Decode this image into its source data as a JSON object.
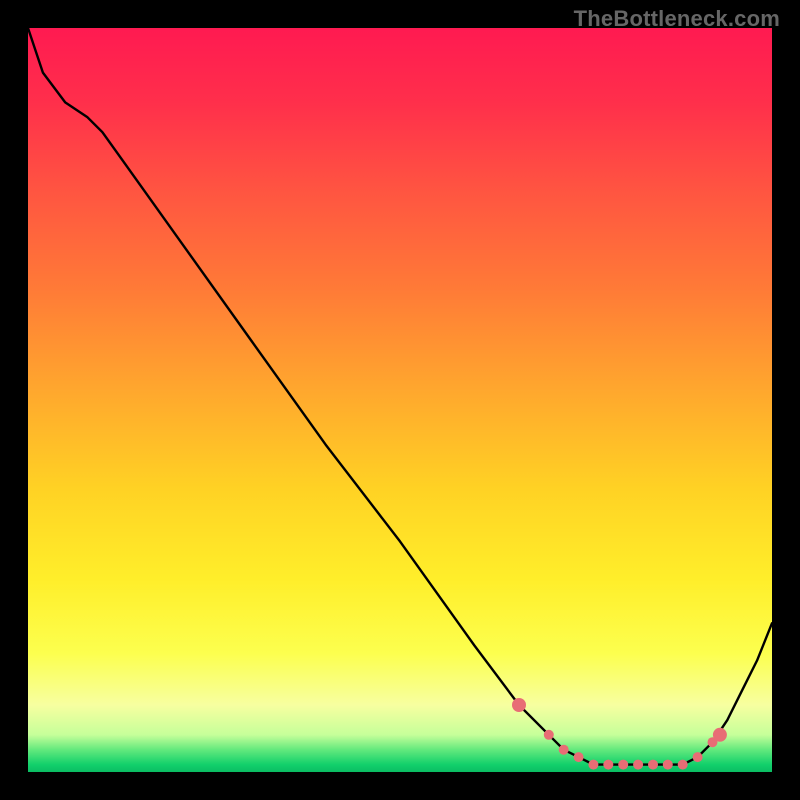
{
  "watermark": "TheBottleneck.com",
  "chart_data": {
    "type": "line",
    "x": [
      0.0,
      0.02,
      0.05,
      0.08,
      0.1,
      0.15,
      0.2,
      0.3,
      0.4,
      0.5,
      0.6,
      0.66,
      0.7,
      0.72,
      0.74,
      0.76,
      0.78,
      0.8,
      0.82,
      0.84,
      0.86,
      0.88,
      0.9,
      0.92,
      0.94,
      0.96,
      0.98,
      1.0
    ],
    "values": [
      1.0,
      0.94,
      0.9,
      0.88,
      0.86,
      0.79,
      0.72,
      0.58,
      0.44,
      0.31,
      0.17,
      0.09,
      0.05,
      0.03,
      0.02,
      0.01,
      0.01,
      0.01,
      0.01,
      0.01,
      0.01,
      0.01,
      0.02,
      0.04,
      0.07,
      0.11,
      0.15,
      0.2
    ],
    "marker_points": {
      "x": [
        0.66,
        0.7,
        0.72,
        0.74,
        0.76,
        0.78,
        0.8,
        0.82,
        0.84,
        0.86,
        0.88,
        0.9,
        0.92,
        0.93
      ],
      "values": [
        0.09,
        0.05,
        0.03,
        0.02,
        0.01,
        0.01,
        0.01,
        0.01,
        0.01,
        0.01,
        0.01,
        0.02,
        0.04,
        0.05
      ]
    },
    "title": "",
    "xlabel": "",
    "ylabel": "",
    "xlim": [
      0,
      1
    ],
    "ylim": [
      0,
      1
    ],
    "annotations": [
      "TheBottleneck.com"
    ]
  }
}
